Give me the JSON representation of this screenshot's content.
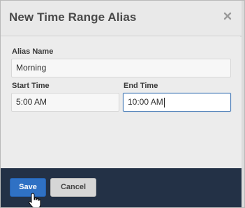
{
  "dialog": {
    "title": "New Time Range Alias",
    "close_glyph": "×"
  },
  "form": {
    "alias_name": {
      "label": "Alias Name",
      "value": "Morning"
    },
    "start_time": {
      "label": "Start Time",
      "value": "5:00 AM"
    },
    "end_time": {
      "label": "End Time",
      "value": "10:00 AM"
    }
  },
  "footer": {
    "save_label": "Save",
    "cancel_label": "Cancel"
  },
  "colors": {
    "accent": "#2f71c4",
    "footer_bg": "#233146"
  }
}
